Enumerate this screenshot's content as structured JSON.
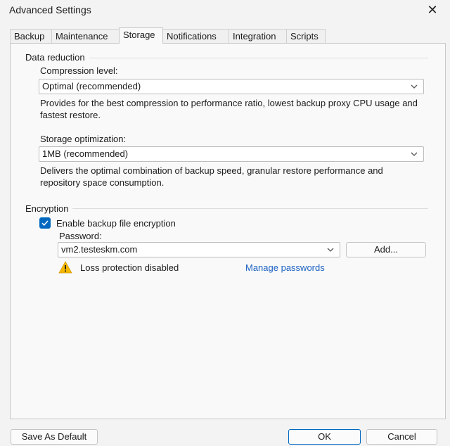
{
  "window": {
    "title": "Advanced Settings"
  },
  "tabs": [
    {
      "label": "Backup"
    },
    {
      "label": "Maintenance"
    },
    {
      "label": "Storage"
    },
    {
      "label": "Notifications"
    },
    {
      "label": "Integration"
    },
    {
      "label": "Scripts"
    }
  ],
  "data_reduction": {
    "section_label": "Data reduction",
    "compression_label": "Compression level:",
    "compression_value": "Optimal (recommended)",
    "compression_description": "Provides for the best compression to performance ratio, lowest backup proxy CPU usage and fastest restore.",
    "optimization_label": "Storage optimization:",
    "optimization_value": "1MB (recommended)",
    "optimization_description": "Delivers the optimal combination of backup speed, granular restore performance and repository space consumption."
  },
  "encryption": {
    "section_label": "Encryption",
    "checkbox_label": "Enable backup file encryption",
    "checked": true,
    "password_label": "Password:",
    "password_value": "vm2.testeskm.com",
    "add_button": "Add...",
    "warning_text": "Loss protection disabled",
    "manage_link": "Manage passwords"
  },
  "footer": {
    "save_default": "Save As Default",
    "ok": "OK",
    "cancel": "Cancel"
  },
  "colors": {
    "accent": "#0067c0",
    "link": "#1a61c2",
    "warning": "#f5b800"
  }
}
